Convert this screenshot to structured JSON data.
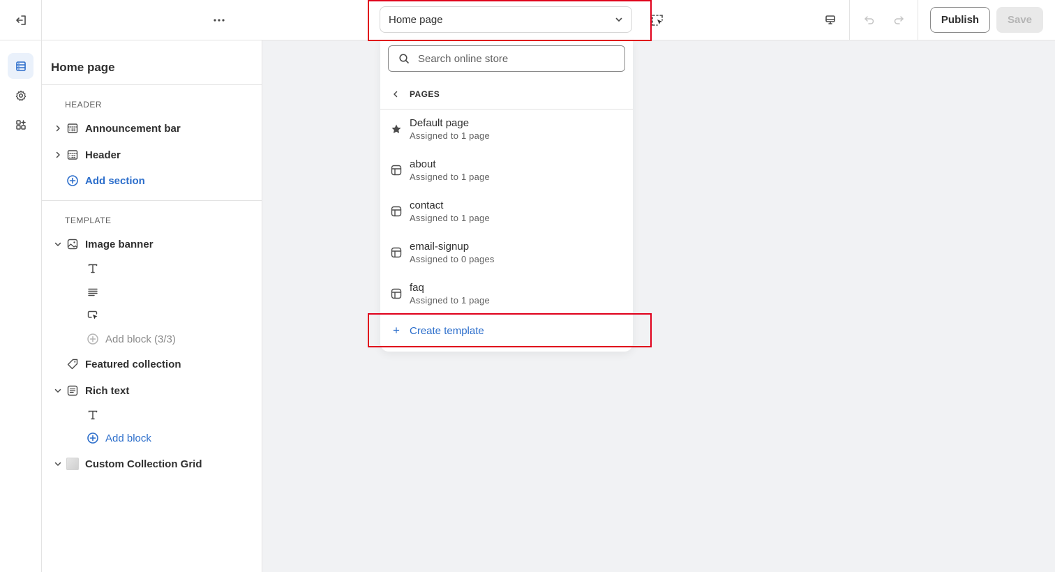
{
  "topbar": {
    "template_select": {
      "label": "Home page"
    },
    "publish_label": "Publish",
    "save_label": "Save",
    "icons": {
      "exit": "exit-icon",
      "more": "more-horizontal-icon",
      "chevron": "chevron-down-icon",
      "inspector": "inspector-select-icon",
      "device": "desktop-icon",
      "undo": "undo-icon",
      "redo": "redo-icon"
    }
  },
  "rail": {
    "items": [
      {
        "icon": "sections-icon",
        "active": true
      },
      {
        "icon": "settings-gear-icon",
        "active": false
      },
      {
        "icon": "apps-icon",
        "active": false
      }
    ]
  },
  "sidebar": {
    "title": "Home page",
    "header_group": {
      "label": "HEADER",
      "items": [
        {
          "label": "Announcement bar",
          "icon": "section-layout-icon"
        },
        {
          "label": "Header",
          "icon": "section-layout-icon"
        }
      ],
      "add_label": "Add section"
    },
    "template_group": {
      "label": "TEMPLATE",
      "image_banner": {
        "label": "Image banner",
        "blocks": [
          {
            "icon": "heading-text-icon"
          },
          {
            "icon": "paragraph-icon"
          },
          {
            "icon": "button-cursor-icon"
          }
        ],
        "add_block_label": "Add block (3/3)"
      },
      "featured_collection": {
        "label": "Featured collection"
      },
      "rich_text": {
        "label": "Rich text",
        "blocks": [
          {
            "icon": "heading-text-icon"
          }
        ],
        "add_block_label": "Add block"
      },
      "custom_collection_grid": {
        "label": "Custom Collection Grid"
      }
    }
  },
  "dropdown": {
    "search_placeholder": "Search online store",
    "section_label": "PAGES",
    "options": [
      {
        "name": "Default page",
        "sub": "Assigned to 1 page",
        "icon": "star-icon"
      },
      {
        "name": "about",
        "sub": "Assigned to 1 page",
        "icon": "template-icon"
      },
      {
        "name": "contact",
        "sub": "Assigned to 1 page",
        "icon": "template-icon"
      },
      {
        "name": "email-signup",
        "sub": "Assigned to 0 pages",
        "icon": "template-icon"
      },
      {
        "name": "faq",
        "sub": "Assigned to 1 page",
        "icon": "template-icon"
      }
    ],
    "create_label": "Create template"
  },
  "colors": {
    "accent": "#2c6ecb",
    "highlight": "#e0001b",
    "canvas": "#f1f2f4"
  }
}
